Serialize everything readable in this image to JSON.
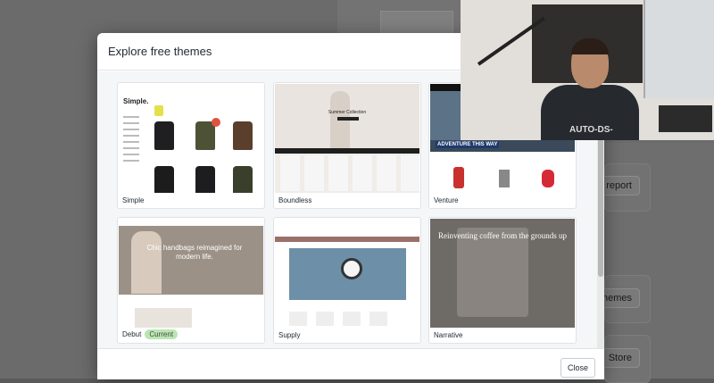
{
  "modal": {
    "title": "Explore free themes",
    "close_label": "Close"
  },
  "themes": [
    {
      "name": "Simple",
      "thumb_logo": "Simple.",
      "is_current": false
    },
    {
      "name": "Boundless",
      "thumb_text": "Summer Collection",
      "is_current": false
    },
    {
      "name": "Venture",
      "thumb_text": "ADVENTURE THIS WAY",
      "is_current": false
    },
    {
      "name": "Debut",
      "thumb_text": "Chic handbags reimagined for modern life.",
      "is_current": true,
      "badge": "Current"
    },
    {
      "name": "Supply",
      "is_current": false
    },
    {
      "name": "Narrative",
      "thumb_text": "Reinventing coffee from the grounds up",
      "is_current": false
    }
  ],
  "background": {
    "buttons": [
      "w report",
      "hemes",
      "Store"
    ]
  },
  "webcam": {
    "shirt_text": "AUTO-DS-"
  }
}
